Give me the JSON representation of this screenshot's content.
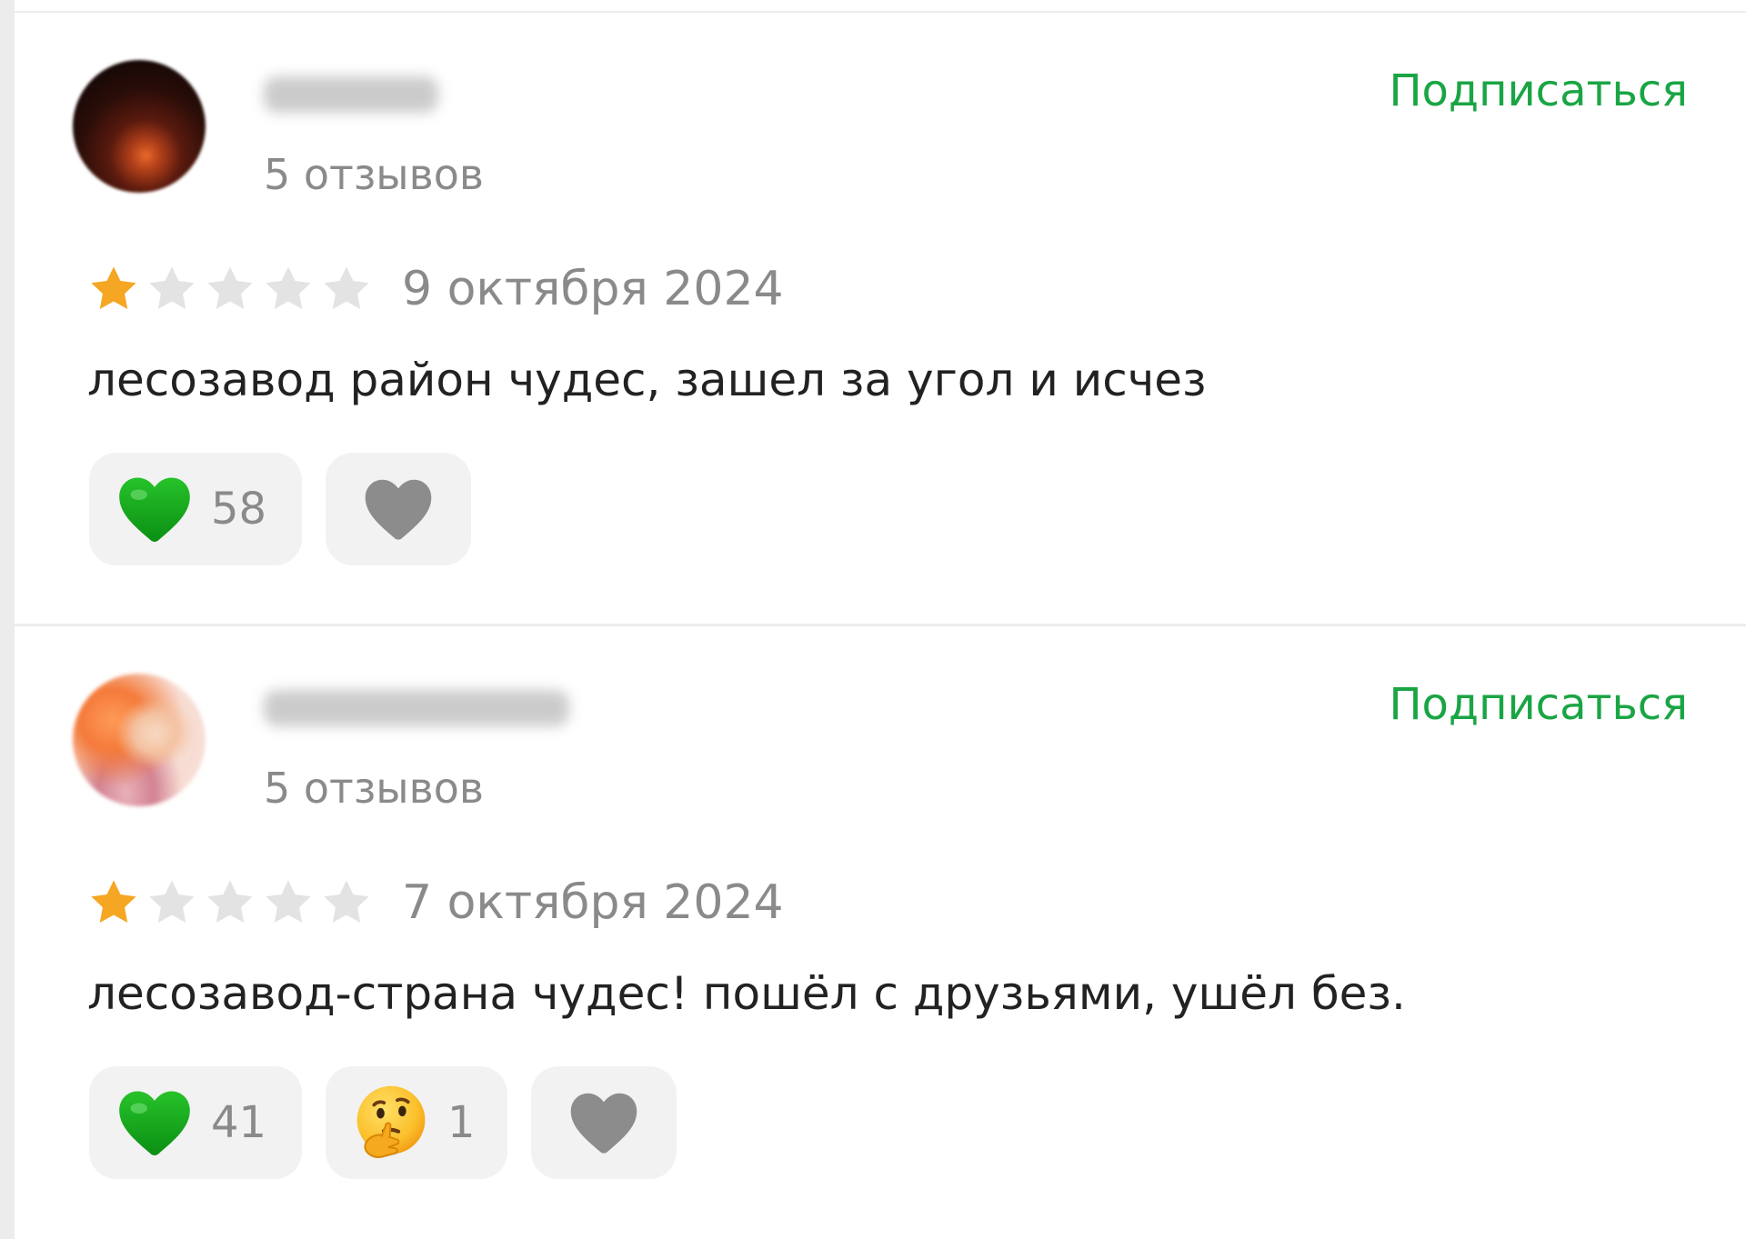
{
  "reviews": [
    {
      "reviews_count": "5 отзывов",
      "subscribe_label": "Подписаться",
      "rating": 1,
      "rating_max": 5,
      "date": "9 октября 2024",
      "text": "лесозавод район чудес, зашел за угол и исчез",
      "reactions": [
        {
          "icon": "green-heart-icon",
          "count": "58"
        },
        {
          "icon": "gray-heart-icon",
          "count": ""
        }
      ]
    },
    {
      "reviews_count": "5 отзывов",
      "subscribe_label": "Подписаться",
      "rating": 1,
      "rating_max": 5,
      "date": "7 октября 2024",
      "text": "лесозавод-страна чудес! пошёл с друзьями, ушёл без.",
      "reactions": [
        {
          "icon": "green-heart-icon",
          "count": "41"
        },
        {
          "icon": "thinking-face-icon",
          "count": "1"
        },
        {
          "icon": "gray-heart-icon",
          "count": ""
        }
      ]
    }
  ],
  "colors": {
    "accent_green": "#1aa544",
    "star_filled": "#f5a623",
    "star_empty": "#e3e3e3",
    "muted_text": "#8a8a8a"
  }
}
